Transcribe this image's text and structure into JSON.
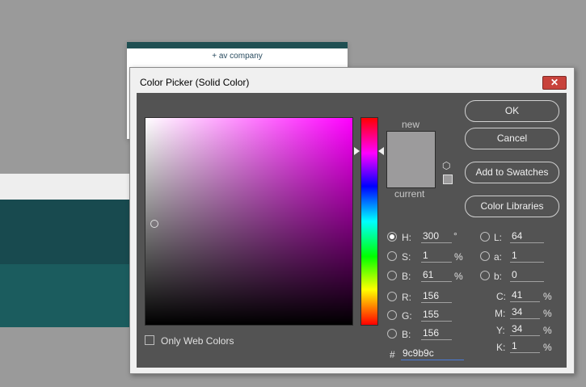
{
  "background": {
    "brand_text": "+ av company"
  },
  "dialog": {
    "title": "Color Picker (Solid Color)",
    "close_glyph": "✕"
  },
  "preview": {
    "new_label": "new",
    "current_label": "current",
    "new_color": "#9c9b9c",
    "current_color": "#9c9b9c"
  },
  "buttons": {
    "ok": "OK",
    "cancel": "Cancel",
    "add_to_swatches": "Add to Swatches",
    "color_libraries": "Color Libraries"
  },
  "hsb": {
    "h": {
      "label": "H:",
      "value": "300",
      "unit": "°"
    },
    "s": {
      "label": "S:",
      "value": "1",
      "unit": "%"
    },
    "b": {
      "label": "B:",
      "value": "61",
      "unit": "%"
    }
  },
  "rgb": {
    "r": {
      "label": "R:",
      "value": "156"
    },
    "g": {
      "label": "G:",
      "value": "155"
    },
    "b": {
      "label": "B:",
      "value": "156"
    }
  },
  "lab": {
    "l": {
      "label": "L:",
      "value": "64"
    },
    "a": {
      "label": "a:",
      "value": "1"
    },
    "b": {
      "label": "b:",
      "value": "0"
    }
  },
  "cmyk": {
    "c": {
      "label": "C:",
      "value": "41",
      "unit": "%"
    },
    "m": {
      "label": "M:",
      "value": "34",
      "unit": "%"
    },
    "y": {
      "label": "Y:",
      "value": "34",
      "unit": "%"
    },
    "k": {
      "label": "K:",
      "value": "1",
      "unit": "%"
    }
  },
  "hex": {
    "label": "#",
    "value": "9c9b9c"
  },
  "only_web_colors": {
    "label": "Only Web Colors",
    "checked": false
  },
  "hue_color": "#ff00ff"
}
